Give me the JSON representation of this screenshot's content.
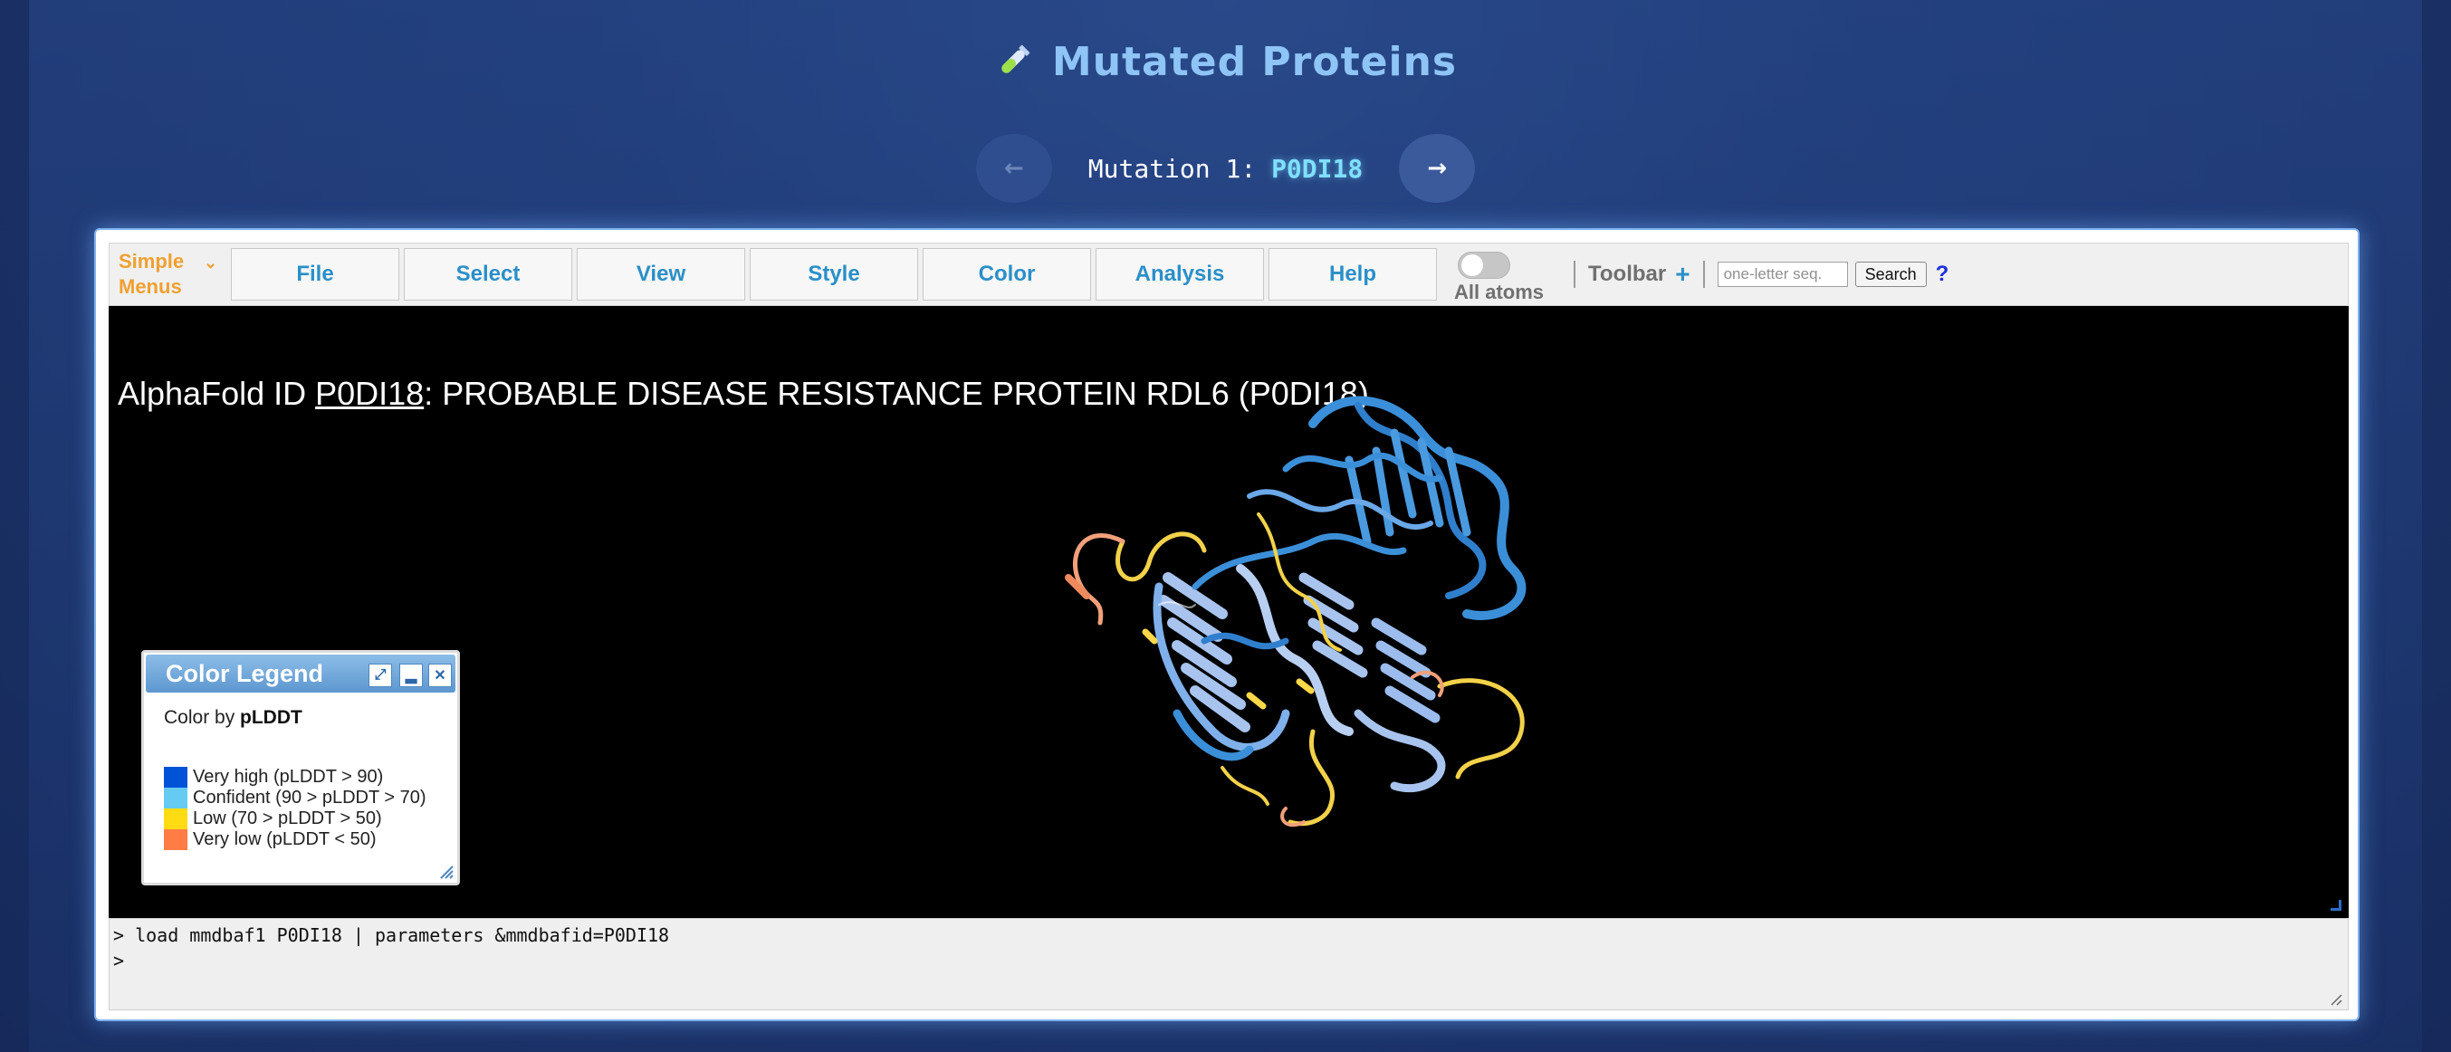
{
  "header": {
    "title": "Mutated Proteins",
    "icon": "test-tube-icon"
  },
  "nav": {
    "prev_symbol": "←",
    "next_symbol": "→",
    "label_prefix": "Mutation 1:",
    "mutation_id": "P0DI18"
  },
  "toolbar": {
    "simple_menus_line1": "Simple",
    "simple_menus_line2": "Menus",
    "menus": [
      "File",
      "Select",
      "View",
      "Style",
      "Color",
      "Analysis",
      "Help"
    ],
    "toggle_label": "All atoms",
    "toolbar_label": "Toolbar",
    "plus_symbol": "+",
    "seq_placeholder": "one-letter seq.",
    "search_label": "Search",
    "help_symbol": "?"
  },
  "viewer": {
    "title_prefix": "AlphaFold ID ",
    "title_id": "P0DI18",
    "title_suffix": ": PROBABLE DISEASE RESISTANCE PROTEIN RDL6 (P0DI18)"
  },
  "legend": {
    "title": "Color Legend",
    "color_by_prefix": "Color by ",
    "color_by_value": "pLDDT",
    "items": [
      {
        "label": "Very high (pLDDT > 90)",
        "color": "#0053d6"
      },
      {
        "label": "Confident (90 > pLDDT > 70)",
        "color": "#65cbf3"
      },
      {
        "label": "Low (70 > pLDDT > 50)",
        "color": "#ffdb13"
      },
      {
        "label": "Very low (pLDDT < 50)",
        "color": "#ff7d45"
      }
    ]
  },
  "console": {
    "lines": [
      "> load mmdbaf1 P0DI18 | parameters &mmdbafid=P0DI18",
      ">"
    ]
  },
  "colors": {
    "accent_title": "#8ec4f6",
    "menu_text": "#2a8fc8",
    "simple_menus": "#f0a030",
    "protein_blue": "#3b8fd8",
    "protein_light": "#a8c4ee"
  }
}
